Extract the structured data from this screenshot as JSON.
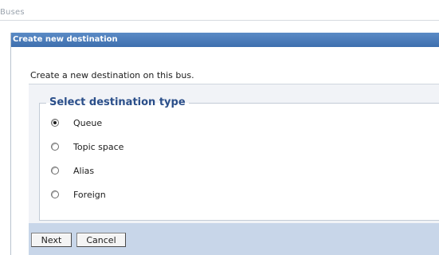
{
  "breadcrumb": "Buses",
  "panel": {
    "title": "Create new destination",
    "intro": "Create a new destination on this bus."
  },
  "destination_type": {
    "legend": "Select destination type",
    "options": [
      {
        "label": "Queue",
        "selected": true
      },
      {
        "label": "Topic space",
        "selected": false
      },
      {
        "label": "Alias",
        "selected": false
      },
      {
        "label": "Foreign",
        "selected": false
      }
    ]
  },
  "buttons": {
    "next": "Next",
    "cancel": "Cancel"
  },
  "colors": {
    "header_bg": "#4a7bb8",
    "legend_text": "#2b4f8a",
    "button_bar_bg": "#c8d6e9"
  }
}
